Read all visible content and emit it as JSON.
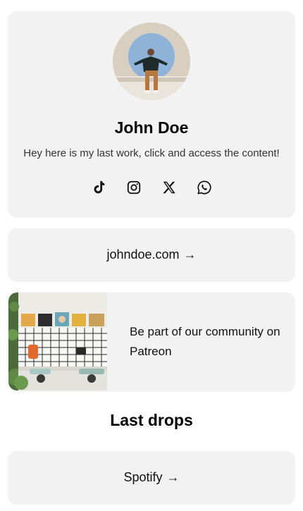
{
  "profile": {
    "name": "John Doe",
    "bio": "Hey here is my last work, click and access the content!",
    "socials": [
      {
        "icon": "tiktok-icon",
        "label": "TikTok"
      },
      {
        "icon": "instagram-icon",
        "label": "Instagram"
      },
      {
        "icon": "x-icon",
        "label": "X"
      },
      {
        "icon": "whatsapp-icon",
        "label": "WhatsApp"
      }
    ]
  },
  "links": {
    "website": {
      "label": "johndoe.com",
      "arrow": "→"
    },
    "patreon": {
      "label": "Be part of our community on Patreon"
    },
    "spotify": {
      "label": "Spotify",
      "arrow": "→"
    }
  },
  "sections": {
    "last_drops": "Last drops"
  },
  "colors": {
    "page_background": "#ffffff",
    "card_background": "#f2f2f2",
    "text": "#111111"
  }
}
